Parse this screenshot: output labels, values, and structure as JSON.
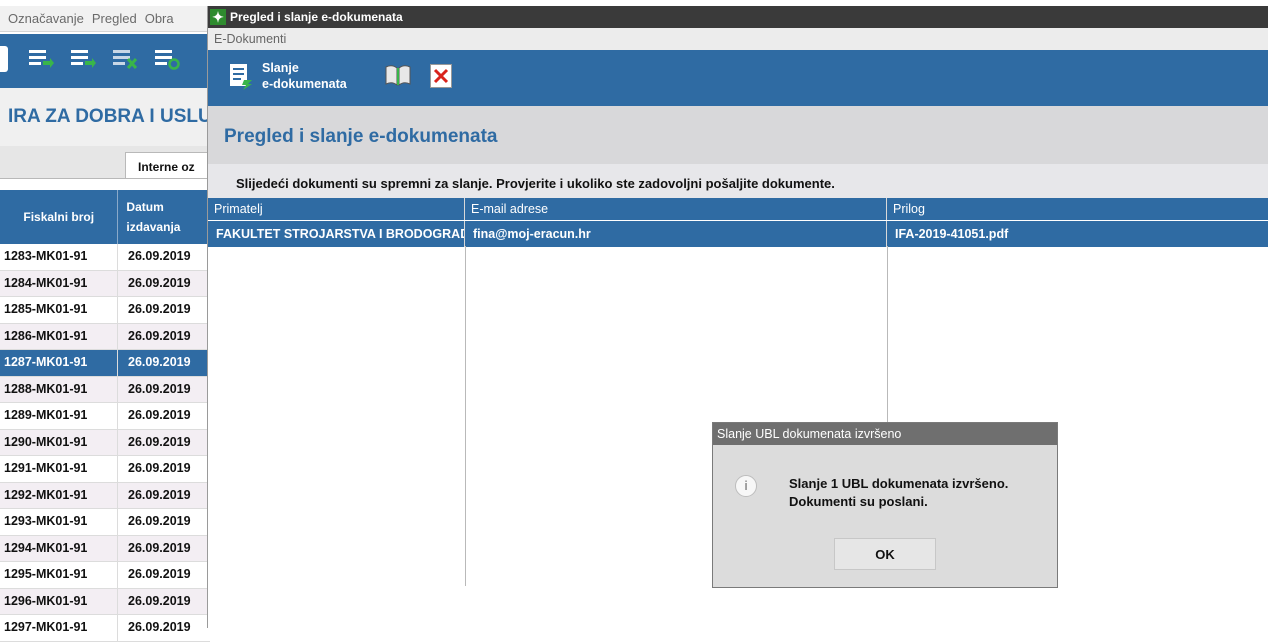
{
  "background_app": {
    "menu": [
      "Označavanje",
      "Pregled",
      "Obra"
    ],
    "title": "IRA ZA DOBRA I USLU",
    "tab_label": "Interne oz",
    "grid": {
      "col1_header": "Fiskalni broj",
      "col2_header_line1": "Datum",
      "col2_header_line2": "izdavanja",
      "rows": [
        {
          "fiskalni": "1283-MK01-91",
          "datum": "26.09.2019"
        },
        {
          "fiskalni": "1284-MK01-91",
          "datum": "26.09.2019"
        },
        {
          "fiskalni": "1285-MK01-91",
          "datum": "26.09.2019"
        },
        {
          "fiskalni": "1286-MK01-91",
          "datum": "26.09.2019"
        },
        {
          "fiskalni": "1287-MK01-91",
          "datum": "26.09.2019"
        },
        {
          "fiskalni": "1288-MK01-91",
          "datum": "26.09.2019"
        },
        {
          "fiskalni": "1289-MK01-91",
          "datum": "26.09.2019"
        },
        {
          "fiskalni": "1290-MK01-91",
          "datum": "26.09.2019"
        },
        {
          "fiskalni": "1291-MK01-91",
          "datum": "26.09.2019"
        },
        {
          "fiskalni": "1292-MK01-91",
          "datum": "26.09.2019"
        },
        {
          "fiskalni": "1293-MK01-91",
          "datum": "26.09.2019"
        },
        {
          "fiskalni": "1294-MK01-91",
          "datum": "26.09.2019"
        },
        {
          "fiskalni": "1295-MK01-91",
          "datum": "26.09.2019"
        },
        {
          "fiskalni": "1296-MK01-91",
          "datum": "26.09.2019"
        },
        {
          "fiskalni": "1297-MK01-91",
          "datum": "26.09.2019"
        }
      ],
      "selected_row": 4
    }
  },
  "window": {
    "title": "Pregled i slanje e-dokumenata",
    "subtitle": "E-Dokumenti",
    "toolbar": {
      "send_line1": "Slanje",
      "send_line2": "e-dokumenata"
    },
    "header": "Pregled i slanje e-dokumenata",
    "info": "Slijedeći dokumenti su spremni za slanje. Provjerite i ukoliko ste zadovoljni pošaljite dokumente.",
    "table": {
      "headers": [
        "Primatelj",
        "E-mail adrese",
        "Prilog"
      ],
      "rows": [
        [
          "FAKULTET STROJARSTVA I BRODOGRADNJE",
          "fina@moj-eracun.hr",
          "IFA-2019-41051.pdf"
        ]
      ]
    }
  },
  "dialog": {
    "title": "Slanje UBL dokumenata izvršeno",
    "message_line1": "Slanje 1 UBL dokumenata izvršeno.",
    "message_line2": "Dokumenti su poslani.",
    "ok_label": "OK"
  },
  "colors": {
    "accent": "#2f6ba3",
    "dialog_title": "#6f6f6f"
  }
}
